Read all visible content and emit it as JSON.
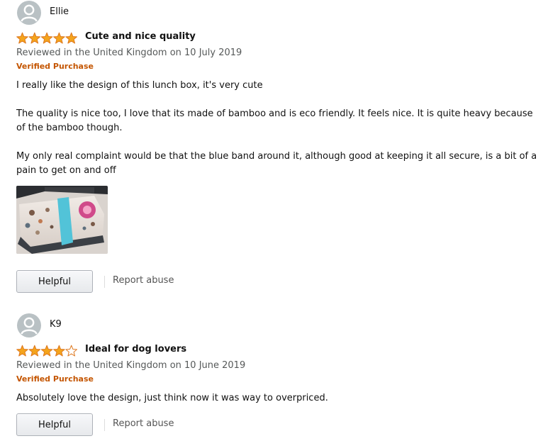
{
  "colors": {
    "star": "#f4a41c",
    "star_outline": "#de7921",
    "verified": "#c45500",
    "date": "#565959",
    "report": "#555555"
  },
  "reviews": [
    {
      "profile_name": "Ellie",
      "rating": 5,
      "rating_max": 5,
      "title": "Cute and nice quality",
      "date": "Reviewed in the United Kingdom on 10 July 2019",
      "verified_label": "Verified Purchase",
      "paragraphs": [
        "I really like the design of this lunch box, it's very cute",
        "The quality is nice too, I love that its made of bamboo and is eco friendly. It feels nice. It is quite heavy because of the bamboo though.",
        "My only real complaint would be that the blue band around it, although good at keeping it all secure, is a bit of a pain to get on and off"
      ],
      "has_image": true,
      "helpful_label": "Helpful",
      "report_label": "Report abuse"
    },
    {
      "profile_name": "K9",
      "rating": 4,
      "rating_max": 5,
      "title": "Ideal for dog lovers",
      "date": "Reviewed in the United Kingdom on 10 June 2019",
      "verified_label": "Verified Purchase",
      "paragraphs": [
        "Absolutely love the design, just think now it was way to overpriced."
      ],
      "has_image": false,
      "helpful_label": "Helpful",
      "report_label": "Report abuse"
    }
  ]
}
